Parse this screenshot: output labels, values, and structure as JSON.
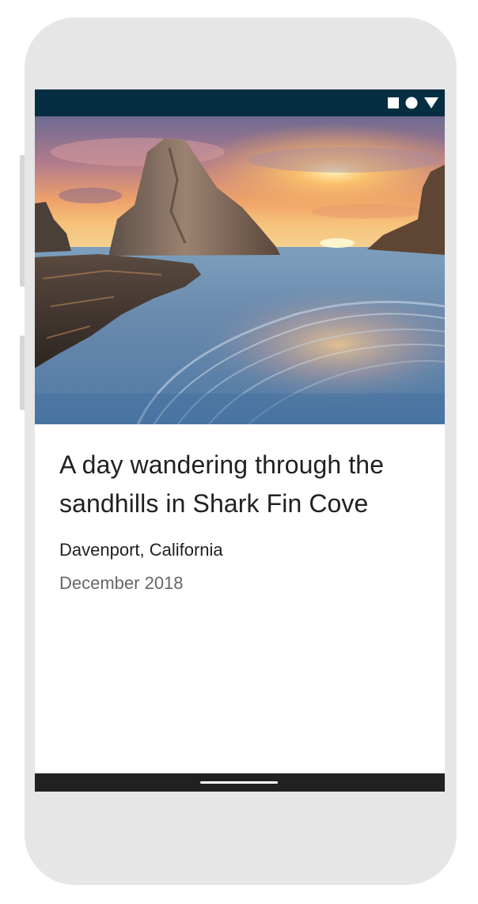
{
  "status_bar": {
    "icons": [
      "square-icon",
      "circle-icon",
      "triangle-icon"
    ],
    "background": "#062e43"
  },
  "hero": {
    "image": "coastal-sea-stack-sunset-photo"
  },
  "article": {
    "title": "A day wandering through the sandhills in Shark Fin Cove",
    "location": "Davenport, California",
    "date": "December 2018"
  },
  "nav_bar": {
    "background": "#212121",
    "handle": "home-gesture-handle"
  }
}
